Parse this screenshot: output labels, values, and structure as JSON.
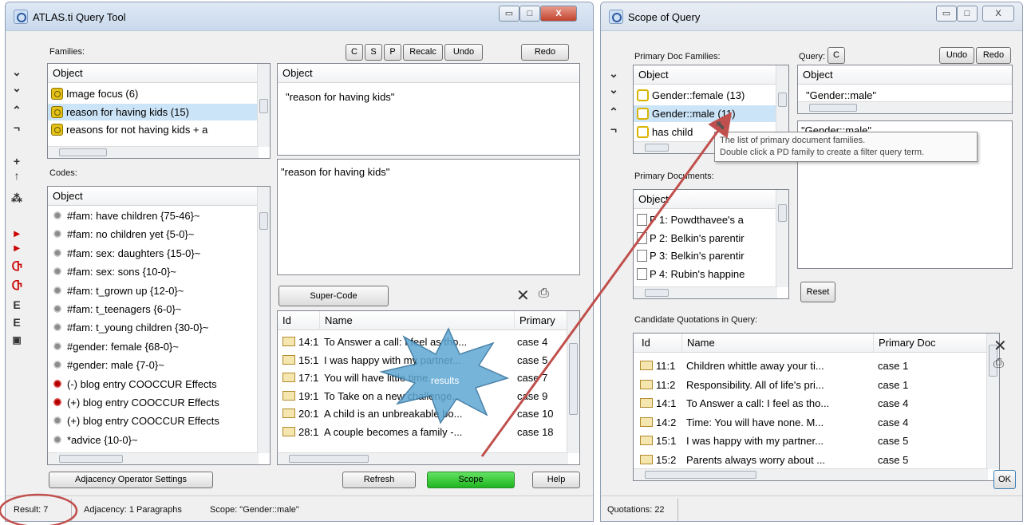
{
  "query_tool": {
    "title": "ATLAS.ti Query Tool",
    "window_buttons": {
      "minimize": "▭",
      "maximize": "□",
      "close": "X"
    },
    "toolbar": {
      "c": "C",
      "s": "S",
      "p": "P",
      "recalc": "Recalc",
      "undo": "Undo",
      "redo": "Redo"
    },
    "families_label": "Families:",
    "families_header": "Object",
    "families": [
      {
        "label": "Image focus (6)"
      },
      {
        "label": "reason for having kids (15)"
      },
      {
        "label": "reasons for not having kids + a"
      }
    ],
    "codes_label": "Codes:",
    "codes_header": "Object",
    "codes": [
      {
        "label": "#fam: have children {75-46}~",
        "icon": "code-icon"
      },
      {
        "label": "#fam: no children yet {5-0}~",
        "icon": "code-icon"
      },
      {
        "label": "#fam: sex: daughters {15-0}~",
        "icon": "code-icon"
      },
      {
        "label": "#fam: sex: sons {10-0}~",
        "icon": "code-icon"
      },
      {
        "label": "#fam: t_grown up {12-0}~",
        "icon": "code-icon"
      },
      {
        "label": "#fam: t_teenagers {6-0}~",
        "icon": "code-icon"
      },
      {
        "label": "#fam: t_young children {30-0}~",
        "icon": "code-icon"
      },
      {
        "label": "#gender: female {68-0}~",
        "icon": "code-icon"
      },
      {
        "label": "#gender: male {7-0}~",
        "icon": "code-icon"
      },
      {
        "label": "(-) blog entry COOCCUR Effects",
        "icon": "red-code-icon"
      },
      {
        "label": "(+) blog entry COOCCUR Effects",
        "icon": "red-code-icon"
      },
      {
        "label": "(+) blog entry COOCCUR Effects",
        "icon": "code-icon"
      },
      {
        "label": "*advice {10-0}~",
        "icon": "code-icon"
      }
    ],
    "term_header": "Object",
    "term_value": "\"reason for having kids\"",
    "query_text": "\"reason for having kids\"",
    "supercode_label": "Super-Code",
    "results_columns": [
      "Id",
      "Name",
      "Primary"
    ],
    "results": [
      {
        "id": "14:1",
        "name": "To Answer a call: I feel as tho...",
        "doc": "case 4"
      },
      {
        "id": "15:1",
        "name": "I was happy with my partner...",
        "doc": "case 5"
      },
      {
        "id": "17:1",
        "name": "You will have little time...",
        "doc": "case 7"
      },
      {
        "id": "19:1",
        "name": "To Take on a new challenge...",
        "doc": "case 9"
      },
      {
        "id": "20:1",
        "name": "A child is an unbreakable bo...",
        "doc": "case 10"
      },
      {
        "id": "28:1",
        "name": "A couple becomes a family -...",
        "doc": "case 18"
      }
    ],
    "results_callout": "results",
    "adjacency_button": "Adjacency Operator Settings",
    "refresh_button": "Refresh",
    "scope_button": "Scope",
    "help_button": "Help",
    "status": {
      "result": "Result: 7",
      "adjacency": "Adjacency: 1 Paragraphs",
      "scope": "Scope: \"Gender::male\""
    }
  },
  "scope_window": {
    "title": "Scope of Query",
    "window_buttons": {
      "minimize": "▭",
      "maximize": "□",
      "close": "X"
    },
    "pd_families_label": "Primary Doc Families:",
    "pd_families_header": "Object",
    "pd_families": [
      {
        "label": "Gender::female (13)"
      },
      {
        "label": "Gender::male (11)"
      },
      {
        "label": "has child"
      }
    ],
    "query_label": "Query:",
    "query_c": "C",
    "undo": "Undo",
    "redo": "Redo",
    "query_header": "Object",
    "query_term": "\"Gender::male\"",
    "query_text": "\"Gender::male\"",
    "tooltip_line1": "The list of primary document families.",
    "tooltip_line2": "Double click a PD family to create a filter query term.",
    "primary_docs_label": "Primary Documents:",
    "primary_docs_header": "Object",
    "primary_docs": [
      {
        "label": "P 1: Powdthavee's a"
      },
      {
        "label": "P 2: Belkin's parentir"
      },
      {
        "label": "P 3: Belkin's parentir"
      },
      {
        "label": "P 4: Rubin's happine"
      }
    ],
    "reset_button": "Reset",
    "candidates_label": "Candidate Quotations in Query:",
    "candidates_columns": [
      "Id",
      "Name",
      "Primary Doc"
    ],
    "candidates": [
      {
        "id": "11:1",
        "name": "Children whittle away your ti...",
        "doc": "case 1"
      },
      {
        "id": "11:2",
        "name": "Responsibility. All of life's pri...",
        "doc": "case 1"
      },
      {
        "id": "14:1",
        "name": "To Answer a call: I feel as tho...",
        "doc": "case 4"
      },
      {
        "id": "14:2",
        "name": "Time: You will have none. M...",
        "doc": "case 4"
      },
      {
        "id": "15:1",
        "name": "I was happy with my partner...",
        "doc": "case 5"
      },
      {
        "id": "15:2",
        "name": "Parents always worry about ...",
        "doc": "case 5"
      }
    ],
    "ok_button": "OK",
    "status": "Quotations: 22"
  },
  "colors": {
    "arrow": "#c0504d",
    "scope_green": "#2fc62f",
    "selection": "#cce4f7"
  }
}
